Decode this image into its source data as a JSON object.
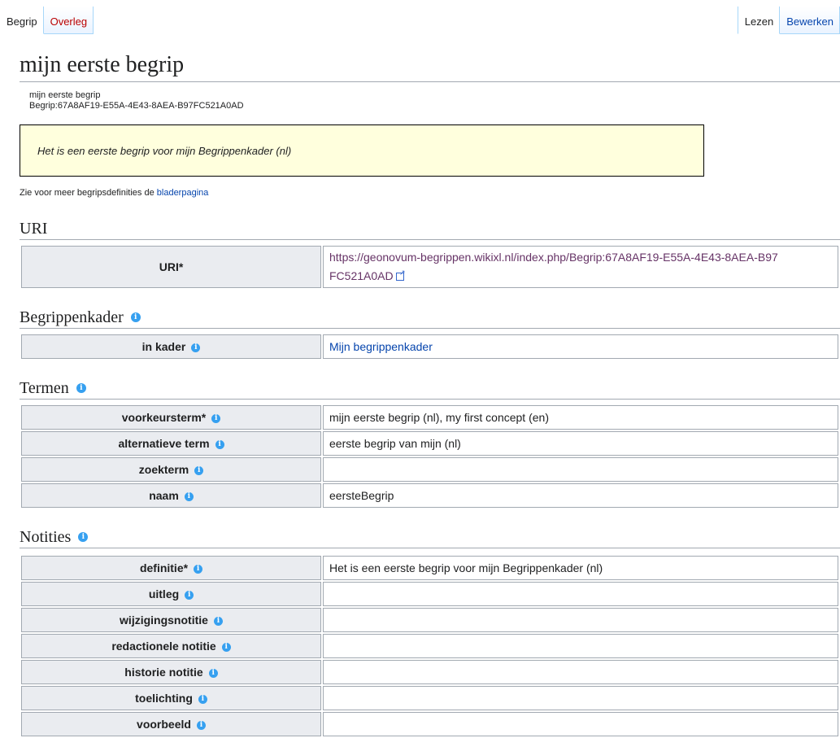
{
  "tabs_left": [
    {
      "label": "Begrip"
    },
    {
      "label": "Overleg"
    }
  ],
  "tabs_right": [
    {
      "label": "Lezen"
    },
    {
      "label": "Bewerken"
    }
  ],
  "page": {
    "title": "mijn eerste begrip",
    "subtitle_line1": "mijn eerste begrip",
    "subtitle_line2": "Begrip:67A8AF19-E55A-4E43-8AEA-B97FC521A0AD",
    "definition_box": "Het is een eerste begrip voor mijn Begrippenkader (nl)",
    "browse_text": "Zie voor meer begripsdefinities de",
    "browse_link": "bladerpagina"
  },
  "sections": {
    "uri": {
      "heading": "URI",
      "label": "URI*",
      "value": "https://geonovum-begrippen.wikixl.nl/index.php/Begrip:67A8AF19-E55A-4E43-8AEA-B97FC521A0AD"
    },
    "kader": {
      "heading": "Begrippenkader",
      "label": "in kader",
      "value": "Mijn begrippenkader"
    },
    "termen": {
      "heading": "Termen",
      "rows": [
        {
          "label": "voorkeursterm*",
          "value": "mijn eerste begrip (nl), my first concept (en)"
        },
        {
          "label": "alternatieve term",
          "value": "eerste begrip van mijn (nl)"
        },
        {
          "label": "zoekterm",
          "value": ""
        },
        {
          "label": "naam",
          "value": "eersteBegrip"
        }
      ]
    },
    "notities": {
      "heading": "Notities",
      "rows": [
        {
          "label": "definitie*",
          "value": "Het is een eerste begrip voor mijn Begrippenkader (nl)"
        },
        {
          "label": "uitleg",
          "value": ""
        },
        {
          "label": "wijzigingsnotitie",
          "value": ""
        },
        {
          "label": "redactionele notitie",
          "value": ""
        },
        {
          "label": "historie notitie",
          "value": ""
        },
        {
          "label": "toelichting",
          "value": ""
        },
        {
          "label": "voorbeeld",
          "value": ""
        }
      ]
    }
  },
  "colors": {
    "info_icon": "#36a0f0",
    "definition_bg": "#ffffdd",
    "label_bg": "#eaecf0",
    "link": "#0645ad",
    "visited_link": "#663366",
    "new_link": "#ba0000"
  }
}
